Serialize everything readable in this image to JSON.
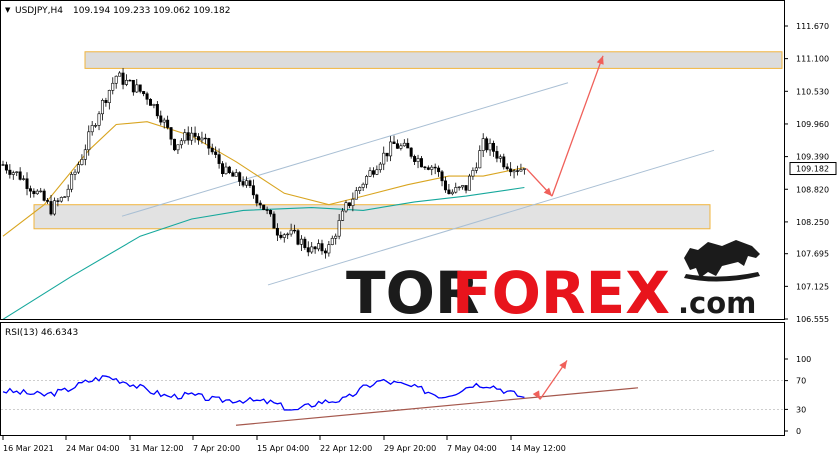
{
  "chart_data": [
    {
      "type": "candlestick",
      "header": {
        "title": "USDJPY,H4",
        "ohlc": "109.194 109.233 109.062 109.182"
      },
      "price_axis": {
        "ticks": [
          "111.670",
          "111.100",
          "110.530",
          "109.960",
          "109.390",
          "108.820",
          "108.250",
          "107.695",
          "107.125",
          "106.555"
        ],
        "ylim": [
          106.555,
          111.67
        ],
        "last_price": "109.182"
      },
      "time_axis": {
        "ticks": [
          "16 Mar 2021",
          "24 Mar 04:00",
          "31 Mar 12:00",
          "7 Apr 20:00",
          "15 Apr 04:00",
          "22 Apr 12:00",
          "29 Apr 20:00",
          "7 May 04:00",
          "14 May 12:00"
        ]
      },
      "close_path": [
        [
          0,
          109.25
        ],
        [
          5,
          109.05
        ],
        [
          10,
          108.75
        ],
        [
          14,
          108.48
        ],
        [
          18,
          108.7
        ],
        [
          23,
          109.4
        ],
        [
          28,
          110.2
        ],
        [
          33,
          110.8
        ],
        [
          37,
          110.65
        ],
        [
          42,
          110.45
        ],
        [
          46,
          110.1
        ],
        [
          50,
          109.6
        ],
        [
          55,
          109.8
        ],
        [
          60,
          109.55
        ],
        [
          65,
          109.1
        ],
        [
          70,
          108.95
        ],
        [
          75,
          108.6
        ],
        [
          80,
          108.1
        ],
        [
          85,
          108.0
        ],
        [
          90,
          107.75
        ],
        [
          95,
          107.8
        ],
        [
          100,
          108.5
        ],
        [
          105,
          108.95
        ],
        [
          110,
          109.35
        ],
        [
          114,
          109.6
        ],
        [
          118,
          109.5
        ],
        [
          122,
          109.3
        ],
        [
          126,
          109.2
        ],
        [
          130,
          108.75
        ],
        [
          135,
          108.85
        ],
        [
          140,
          109.6
        ],
        [
          143,
          109.5
        ],
        [
          146,
          109.3
        ],
        [
          149,
          109.2
        ],
        [
          152,
          109.182
        ]
      ],
      "moving_averages": [
        {
          "color": "#d9a521",
          "points": [
            [
              0,
              108.0
            ],
            [
              12,
              108.55
            ],
            [
              25,
              109.5
            ],
            [
              33,
              109.95
            ],
            [
              42,
              110.0
            ],
            [
              55,
              109.75
            ],
            [
              68,
              109.3
            ],
            [
              82,
              108.75
            ],
            [
              95,
              108.55
            ],
            [
              105,
              108.7
            ],
            [
              118,
              108.9
            ],
            [
              130,
              109.05
            ],
            [
              140,
              109.05
            ],
            [
              152,
              109.2
            ]
          ]
        },
        {
          "color": "#16a89c",
          "points": [
            [
              0,
              106.55
            ],
            [
              20,
              107.3
            ],
            [
              40,
              108.0
            ],
            [
              55,
              108.3
            ],
            [
              70,
              108.45
            ],
            [
              90,
              108.5
            ],
            [
              105,
              108.45
            ],
            [
              120,
              108.6
            ],
            [
              135,
              108.7
            ],
            [
              152,
              108.85
            ]
          ]
        }
      ],
      "resistance_zone": [
        110.93,
        111.22
      ],
      "support_zone": [
        108.13,
        108.55
      ],
      "rsi": {
        "label": "RSI(13) 46.6343",
        "ticks": [
          "100",
          "70",
          "30",
          "0"
        ],
        "ylim": [
          0,
          100
        ],
        "points": [
          [
            0,
            56
          ],
          [
            6,
            53
          ],
          [
            12,
            50
          ],
          [
            18,
            56
          ],
          [
            24,
            68
          ],
          [
            30,
            76
          ],
          [
            36,
            68
          ],
          [
            42,
            57
          ],
          [
            48,
            48
          ],
          [
            55,
            50
          ],
          [
            62,
            43
          ],
          [
            70,
            43
          ],
          [
            78,
            40
          ],
          [
            85,
            28
          ],
          [
            92,
            40
          ],
          [
            100,
            44
          ],
          [
            105,
            60
          ],
          [
            110,
            70
          ],
          [
            116,
            65
          ],
          [
            122,
            58
          ],
          [
            128,
            48
          ],
          [
            132,
            54
          ],
          [
            137,
            65
          ],
          [
            142,
            64
          ],
          [
            147,
            55
          ],
          [
            152,
            46.6343
          ]
        ]
      }
    }
  ],
  "watermark": {
    "text_dark_1": "TOR",
    "text_red": "FOREX",
    "text_dark_2": ".com"
  }
}
